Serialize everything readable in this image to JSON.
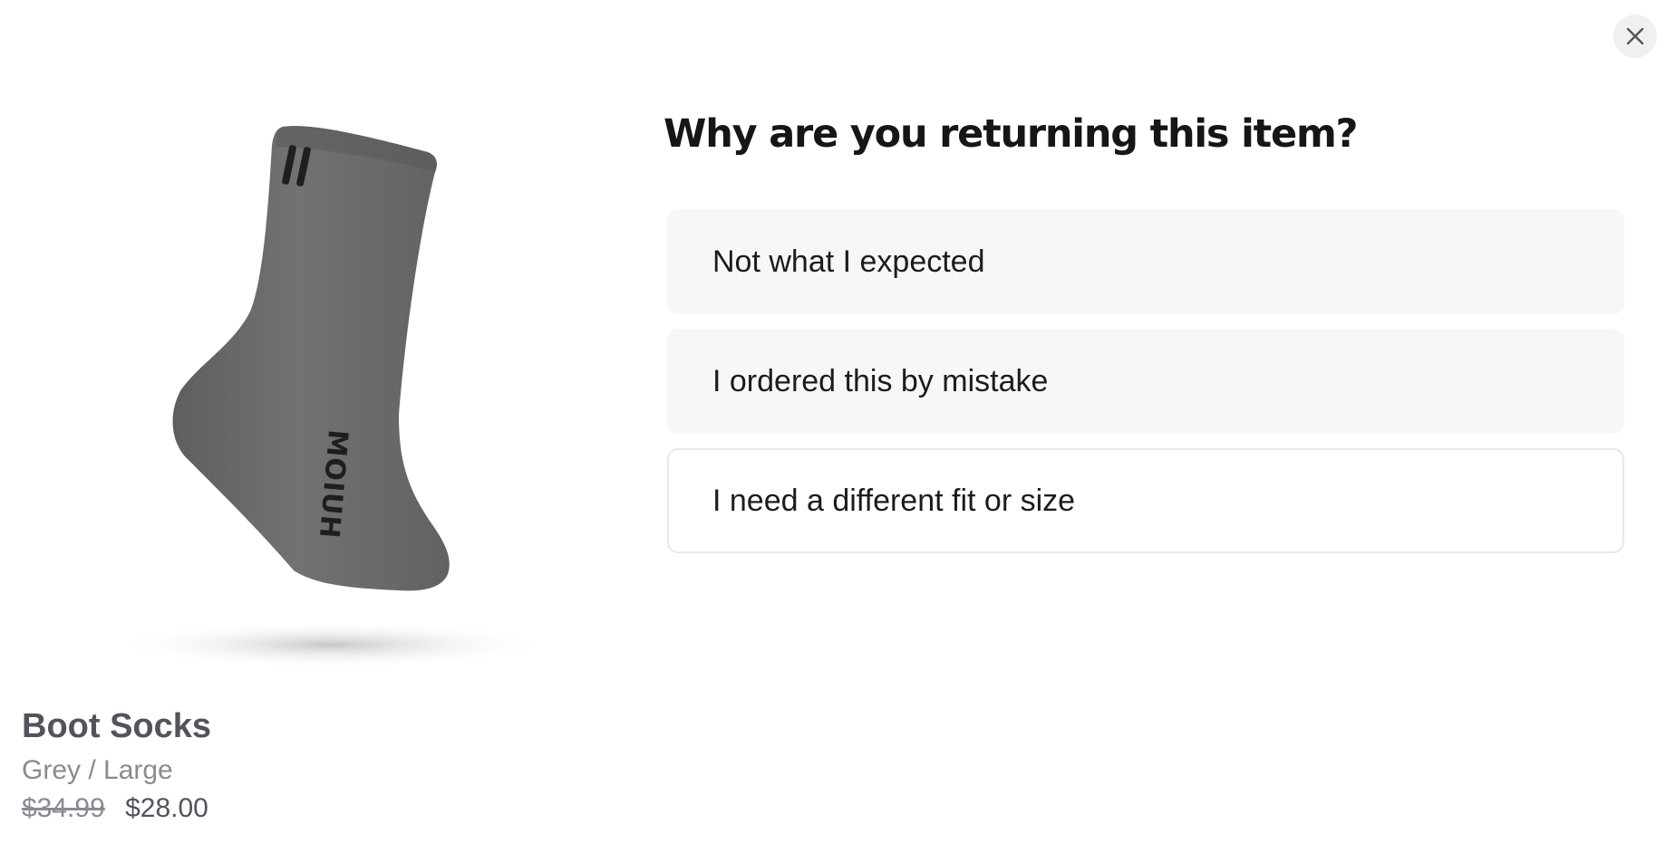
{
  "modal": {
    "close_icon": "close-icon",
    "question": "Why are you returning this item?"
  },
  "product": {
    "name": "Boot Socks",
    "variant": "Grey / Large",
    "price_original": "$34.99",
    "price_sale": "$28.00",
    "image_icon": "sock-product-image",
    "brand_mark": "MOIUH"
  },
  "reasons": [
    {
      "label": "Not what I expected"
    },
    {
      "label": "I ordered this by mistake"
    },
    {
      "label": "I need a different fit or size"
    }
  ],
  "colors": {
    "option_bg": "#f7f7f7",
    "option_border": "#e8e8e8",
    "sock_grey": "#6a6a6a",
    "text_dark": "#161616",
    "text_muted": "#8a8a93"
  }
}
